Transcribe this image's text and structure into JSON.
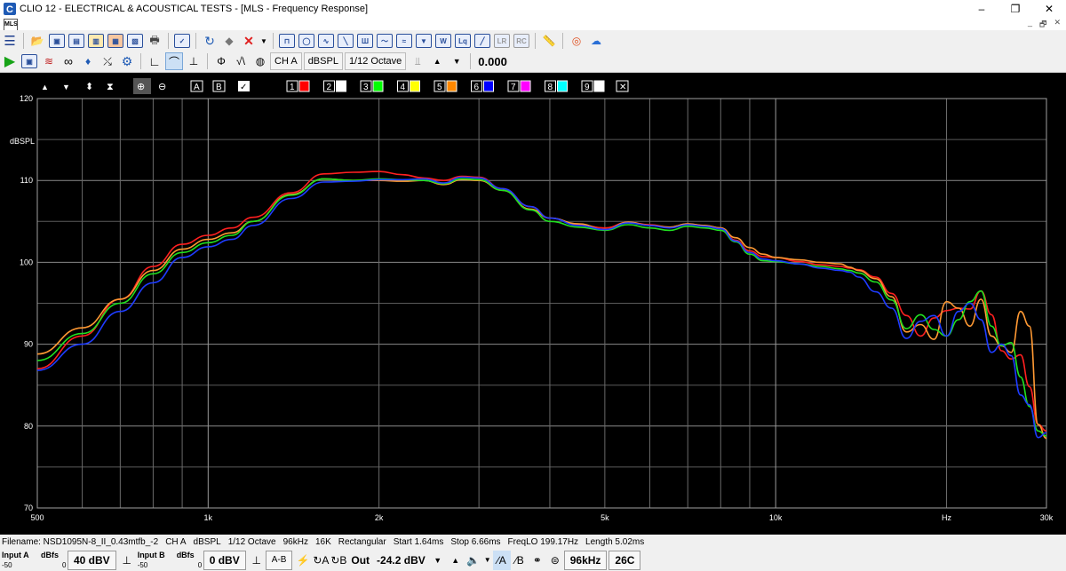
{
  "window": {
    "title": "CLIO 12 - ELECTRICAL & ACOUSTICAL TESTS - [MLS - Frequency Response]"
  },
  "menubar": {
    "mdi_icon": "MLS"
  },
  "toolbar2": {
    "channel": "CH A",
    "unit": "dBSPL",
    "smoothing": "1/12 Octave",
    "reference_value": "0.000"
  },
  "graph_toolbar": {
    "buttons": [
      "A",
      "B"
    ],
    "overlays": [
      {
        "label": "1",
        "color": "#ff0000"
      },
      {
        "label": "2",
        "color": "#ffffff"
      },
      {
        "label": "3",
        "color": "#00ff00"
      },
      {
        "label": "4",
        "color": "#ffff00"
      },
      {
        "label": "5",
        "color": "#ff8800"
      },
      {
        "label": "6",
        "color": "#0000ff"
      },
      {
        "label": "7",
        "color": "#ff00ff"
      },
      {
        "label": "8",
        "color": "#00ffff"
      },
      {
        "label": "9",
        "color": "#ffffff"
      }
    ]
  },
  "chart_data": {
    "type": "line",
    "ylabel": "dBSPL",
    "xscale": "log",
    "xlim": [
      500,
      30000
    ],
    "ylim": [
      70,
      120
    ],
    "y_ticks": [
      120,
      110,
      100,
      90,
      80,
      70
    ],
    "x_tick_labels": [
      {
        "value": 500,
        "label": "500"
      },
      {
        "value": 1000,
        "label": "1k"
      },
      {
        "value": 2000,
        "label": "2k"
      },
      {
        "value": 5000,
        "label": "5k"
      },
      {
        "value": 10000,
        "label": "10k"
      },
      {
        "value": 20000,
        "label": "Hz"
      },
      {
        "value": 30000,
        "label": "30k"
      }
    ],
    "grid": true,
    "series": [
      {
        "color": "#ff2020",
        "x": [
          500,
          600,
          700,
          800,
          900,
          1000,
          1100,
          1200,
          1400,
          1600,
          1800,
          2000,
          2200,
          2400,
          2600,
          2800,
          3000,
          3300,
          3700,
          4000,
          4500,
          5000,
          5500,
          6000,
          6500,
          7000,
          7500,
          8000,
          8500,
          9000,
          9500,
          10000,
          11000,
          12000,
          13000,
          13500,
          14000,
          15000,
          16000,
          17000,
          18000,
          19000,
          20000,
          21000,
          22000,
          23000,
          24000,
          25000,
          26000,
          27000,
          28000,
          29000,
          30000
        ],
        "y": [
          87,
          91,
          95.5,
          99.5,
          102.2,
          103.3,
          104.2,
          105.5,
          108.5,
          110.8,
          111.0,
          111.1,
          110.7,
          110.3,
          110.0,
          110.5,
          110.4,
          109.0,
          106.8,
          105.4,
          104.6,
          104.2,
          104.9,
          104.6,
          104.3,
          104.7,
          104.5,
          104.2,
          102.7,
          101.4,
          100.7,
          100.6,
          100.1,
          99.7,
          99.5,
          99.3,
          99.1,
          98.2,
          96.2,
          93.5,
          91.0,
          93.2,
          94.1,
          94.4,
          94.3,
          96.5,
          93.6,
          89.2,
          88.2,
          88.7,
          84.8,
          80.2,
          79.4
        ]
      },
      {
        "color": "#ff9933",
        "x": [
          500,
          600,
          700,
          800,
          900,
          1000,
          1100,
          1200,
          1400,
          1600,
          1800,
          2000,
          2200,
          2400,
          2600,
          2800,
          3000,
          3300,
          3700,
          4000,
          4500,
          5000,
          5500,
          6000,
          6500,
          7000,
          7500,
          8000,
          8500,
          9000,
          9500,
          10000,
          11000,
          12000,
          13000,
          13500,
          14000,
          15000,
          16000,
          17000,
          18000,
          19000,
          20000,
          21000,
          22000,
          23000,
          24000,
          25000,
          26000,
          27000,
          28000,
          29000,
          30000
        ],
        "y": [
          88.8,
          92,
          95.5,
          99,
          101.6,
          102.8,
          103.6,
          105,
          108.3,
          110.2,
          110.0,
          110.0,
          109.9,
          110.0,
          109.5,
          110.1,
          110.0,
          108.8,
          106.5,
          105.4,
          104.7,
          104.0,
          104.9,
          104.5,
          104.3,
          104.7,
          104.5,
          104.2,
          103.0,
          101.8,
          101.0,
          100.6,
          100.3,
          100.0,
          99.8,
          99.4,
          99.0,
          98.0,
          95.8,
          91.5,
          92.4,
          90.6,
          95.2,
          94.4,
          92.2,
          95.5,
          91.0,
          89.8,
          89.0,
          94.0,
          92.2,
          80.2,
          78.5
        ]
      },
      {
        "color": "#20e020",
        "x": [
          500,
          600,
          700,
          800,
          900,
          1000,
          1100,
          1200,
          1400,
          1600,
          1800,
          2000,
          2200,
          2400,
          2600,
          2800,
          3000,
          3300,
          3700,
          4000,
          4500,
          5000,
          5500,
          6000,
          6500,
          7000,
          7500,
          8000,
          8500,
          9000,
          9500,
          10000,
          11000,
          12000,
          13000,
          13500,
          14000,
          15000,
          16000,
          17000,
          18000,
          19000,
          20000,
          21000,
          22000,
          23000,
          24000,
          25000,
          26000,
          27000,
          28000,
          29000,
          30000
        ],
        "y": [
          88,
          91.3,
          95,
          98.6,
          101.2,
          102.4,
          103.3,
          105,
          108.2,
          110.2,
          110.0,
          110.2,
          110.1,
          110.0,
          109.6,
          110.2,
          110.1,
          108.8,
          106.4,
          105.0,
          104.3,
          103.9,
          104.6,
          104.2,
          103.9,
          104.4,
          104.2,
          103.9,
          102.5,
          101.0,
          100.2,
          100.1,
          99.8,
          99.5,
          99.2,
          99.0,
          98.7,
          97.6,
          95.4,
          91.9,
          93.6,
          91.8,
          91.0,
          93.0,
          95.2,
          96.5,
          92.2,
          89.8,
          90.2,
          86.0,
          82.4,
          79.4,
          78.8
        ]
      },
      {
        "color": "#1e3cff",
        "x": [
          500,
          600,
          700,
          800,
          900,
          1000,
          1100,
          1200,
          1400,
          1600,
          1800,
          2000,
          2200,
          2400,
          2600,
          2800,
          3000,
          3300,
          3700,
          4000,
          4500,
          5000,
          5500,
          6000,
          6500,
          7000,
          7500,
          8000,
          8500,
          9000,
          9500,
          10000,
          11000,
          12000,
          13000,
          13500,
          14000,
          15000,
          16000,
          17000,
          18000,
          19000,
          20000,
          21000,
          22000,
          23000,
          24000,
          25000,
          26000,
          27000,
          28000,
          29000,
          30000
        ],
        "y": [
          86.8,
          90,
          94,
          97.5,
          100.6,
          101.9,
          102.8,
          104.5,
          107.8,
          109.8,
          109.9,
          110.1,
          110.1,
          110.2,
          109.7,
          110.4,
          110.3,
          109.0,
          106.8,
          105.4,
          104.5,
          104.0,
          104.8,
          104.5,
          104.2,
          104.6,
          104.4,
          104.1,
          102.6,
          101.2,
          100.4,
          100.2,
          99.8,
          99.3,
          99.0,
          98.8,
          98.2,
          96.4,
          94.4,
          90.7,
          92.8,
          93.5,
          91.0,
          94.0,
          95.0,
          93.0,
          89.0,
          90.0,
          88.6,
          83.8,
          82.6,
          78.6,
          79.2
        ]
      }
    ]
  },
  "status_info": {
    "filename": "Filename: NSD1095N-8_II_0.43mtfb_-2",
    "channel": "CH A",
    "unit": "dBSPL",
    "smoothing": "1/12 Octave",
    "rate": "96kHz",
    "size": "16K",
    "window": "Rectangular",
    "start": "Start 1.64ms",
    "stop": "Stop 6.66ms",
    "freqlo": "FreqLO 199.17Hz",
    "length": "Length 5.02ms"
  },
  "status_controls": {
    "input_a_label": "Input A",
    "input_b_label": "Input B",
    "dbfs_label": "dBfs",
    "meter_min": "-50",
    "meter_max": "0",
    "input_a_range": "40 dBV",
    "input_b_range": "0 dBV",
    "ab_label": "A-B",
    "out_label": "Out",
    "out_level": "-24.2 dBV",
    "sample_rate": "96kHz",
    "temperature": "26C"
  }
}
